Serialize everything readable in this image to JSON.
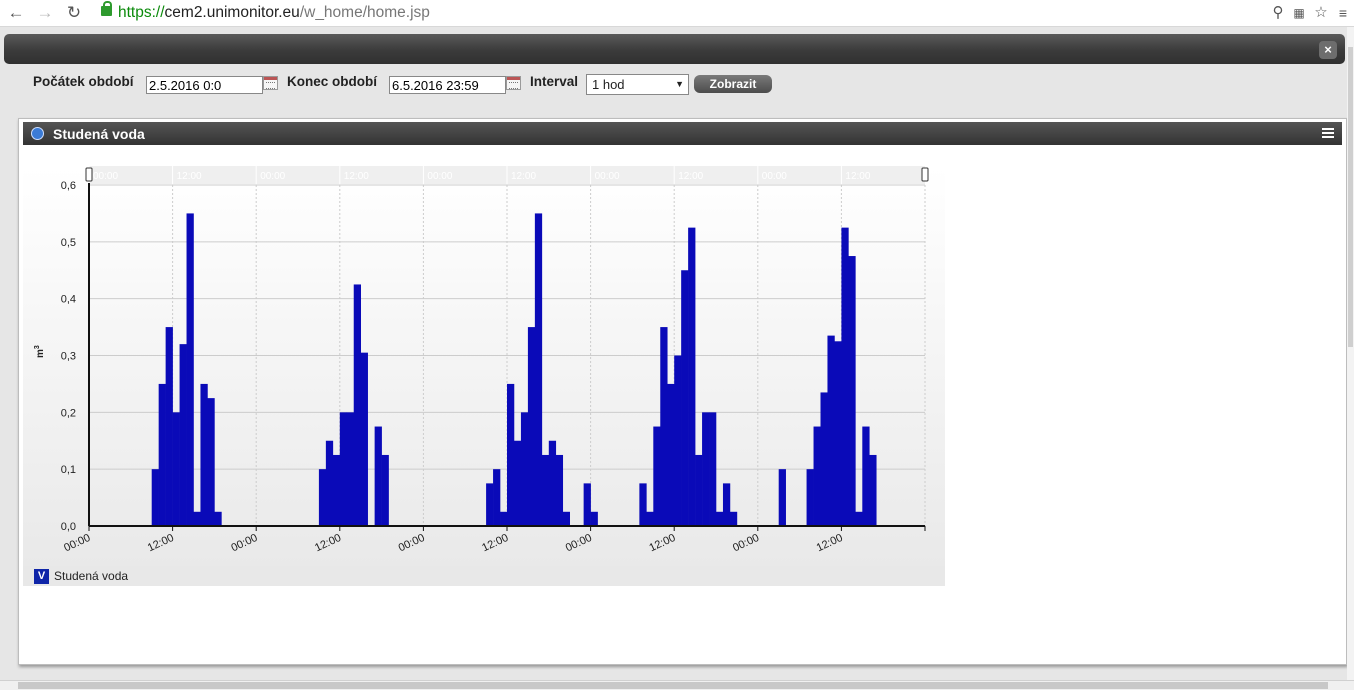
{
  "browser": {
    "url_scheme": "https://",
    "url_host": "cem2.unimonitor.eu",
    "url_path": "/w_home/home.jsp",
    "back_icon": "arrow-left-icon",
    "forward_icon": "arrow-right-icon",
    "reload_icon": "reload-icon"
  },
  "filters": {
    "start_label": "Počátek období",
    "start_value": "2.5.2016 0:0",
    "end_label": "Konec období",
    "end_value": "6.5.2016 23:59",
    "interval_label": "Interval",
    "interval_value": "1 hod",
    "show_button": "Zobrazit"
  },
  "panel": {
    "title": "Studená voda"
  },
  "legend": {
    "label": "Studená voda",
    "check": "V"
  },
  "colors": {
    "bar": "#0a0ab8",
    "panel_header": "#3a3a3a"
  },
  "chart_data": {
    "type": "bar",
    "title": "Studená voda",
    "ylabel": "m3",
    "ylim": [
      0,
      0.6
    ],
    "yticks": [
      "0,0",
      "0,1",
      "0,2",
      "0,3",
      "0,4",
      "0,5",
      "0,6"
    ],
    "xticks": [
      "00:00",
      "12:00",
      "00:00",
      "12:00",
      "00:00",
      "12:00",
      "00:00",
      "12:00",
      "00:00",
      "12:00"
    ],
    "x_start": "2.5.2016 0:00",
    "x_end": "6.5.2016 23:59",
    "interval": "1 hod",
    "grid": true,
    "series": [
      {
        "name": "Studená voda",
        "values": [
          0,
          0,
          0,
          0,
          0,
          0,
          0,
          0,
          0,
          0.1,
          0.25,
          0.35,
          0.2,
          0.32,
          0.55,
          0.025,
          0.25,
          0.225,
          0.025,
          0,
          0,
          0,
          0,
          0,
          0,
          0,
          0,
          0,
          0,
          0,
          0,
          0,
          0,
          0.1,
          0.15,
          0.125,
          0.2,
          0.2,
          0.425,
          0.305,
          0,
          0.175,
          0.125,
          0,
          0,
          0,
          0,
          0,
          0,
          0,
          0,
          0,
          0,
          0,
          0,
          0,
          0,
          0.075,
          0.1,
          0.025,
          0.25,
          0.15,
          0.2,
          0.35,
          0.55,
          0.125,
          0.15,
          0.125,
          0.025,
          0,
          0,
          0.075,
          0.025,
          0,
          0,
          0,
          0,
          0,
          0,
          0.075,
          0.025,
          0.175,
          0.35,
          0.25,
          0.3,
          0.45,
          0.525,
          0.125,
          0.2,
          0.2,
          0.025,
          0.075,
          0.025,
          0,
          0,
          0,
          0,
          0,
          0,
          0.1,
          0,
          0,
          0,
          0.1,
          0.175,
          0.235,
          0.335,
          0.325,
          0.525,
          0.475,
          0.025,
          0.175,
          0.125,
          0,
          0,
          0,
          0,
          0,
          0,
          0,
          0,
          0
        ]
      }
    ]
  }
}
